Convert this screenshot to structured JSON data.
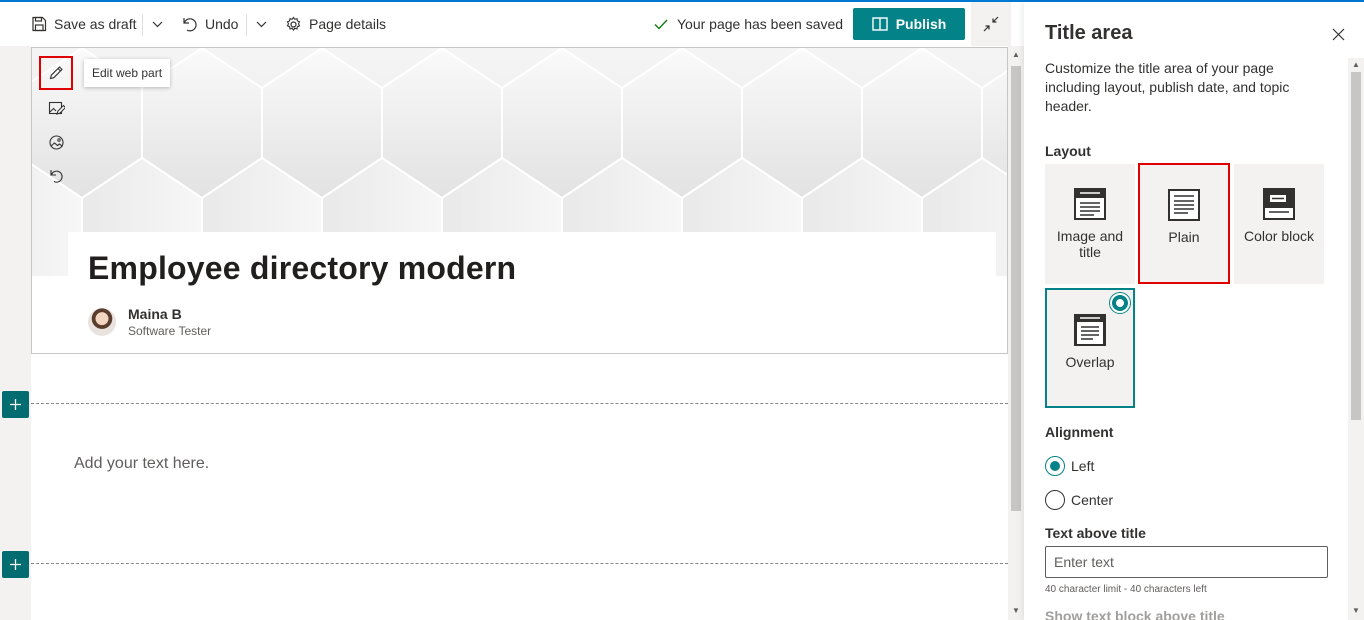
{
  "command_bar": {
    "save_draft": "Save as draft",
    "undo": "Undo",
    "page_details": "Page details",
    "saved_status": "Your page has been saved",
    "publish": "Publish"
  },
  "hero": {
    "tooltip": "Edit web part",
    "title": "Employee directory modern",
    "author_name": "Maina B",
    "author_role": "Software Tester"
  },
  "canvas": {
    "placeholder": "Add your text here."
  },
  "panel": {
    "title": "Title area",
    "description": "Customize the title area of your page including layout, publish date, and topic header.",
    "layout_label": "Layout",
    "layouts": [
      {
        "label": "Image and title",
        "icon": "image-and-title-layout-icon"
      },
      {
        "label": "Plain",
        "icon": "plain-layout-icon"
      },
      {
        "label": "Color block",
        "icon": "color-block-layout-icon"
      },
      {
        "label": "Overlap",
        "icon": "overlap-layout-icon"
      }
    ],
    "selected_layout": "Overlap",
    "alignment_label": "Alignment",
    "alignment_options": [
      "Left",
      "Center"
    ],
    "selected_alignment": "Left",
    "text_above_label": "Text above title",
    "text_above_placeholder": "Enter text",
    "char_hint": "40 character limit - 40 characters left",
    "show_text_block": "Show text block above title"
  },
  "colors": {
    "accent": "#038387",
    "highlight": "#e00000",
    "top_line": "#0078d4"
  }
}
